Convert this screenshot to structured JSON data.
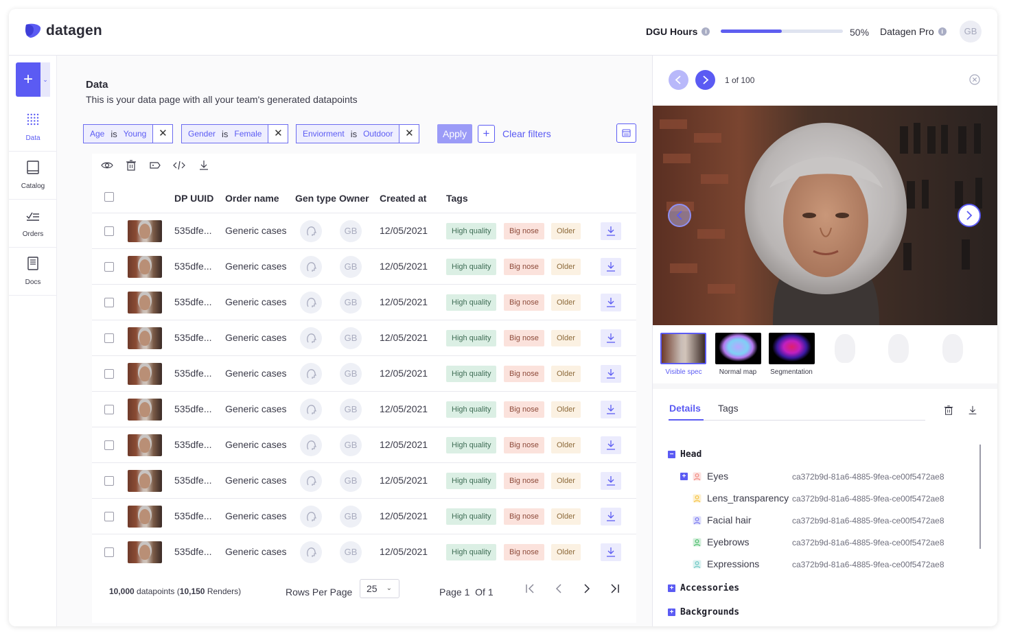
{
  "app": {
    "logo_text": "datagen",
    "brand_color": "#5b5bf3"
  },
  "header": {
    "dgu_label": "DGU Hours",
    "dgu_progress": 0.5,
    "dgu_percent": "50%",
    "plan_label": "Datagen Pro",
    "avatar": "GB"
  },
  "sidebar": {
    "items": [
      {
        "label": "Data",
        "icon": "grid-icon",
        "active": true
      },
      {
        "label": "Catalog",
        "icon": "book-icon",
        "active": false
      },
      {
        "label": "Orders",
        "icon": "checklist-icon",
        "active": false
      },
      {
        "label": "Docs",
        "icon": "document-icon",
        "active": false
      }
    ]
  },
  "page": {
    "title": "Data",
    "subtitle": "This is your data page with all your team's generated datapoints"
  },
  "filters": {
    "chips": [
      {
        "field": "Age",
        "op": "is",
        "value": "Young"
      },
      {
        "field": "Gender",
        "op": "is",
        "value": "Female"
      },
      {
        "field": "Enviorment",
        "op": "is",
        "value": "Outdoor"
      }
    ],
    "apply": "Apply",
    "clear": "Clear filters"
  },
  "table": {
    "columns": [
      "DP UUID",
      "Order name",
      "Gen type",
      "Owner",
      "Created at",
      "Tags"
    ],
    "rows": [
      {
        "uuid": "535dfe...",
        "order": "Generic cases",
        "owner": "GB",
        "created": "12/05/2021",
        "tags": [
          "High quality",
          "Big nose",
          "Older"
        ]
      },
      {
        "uuid": "535dfe...",
        "order": "Generic cases",
        "owner": "GB",
        "created": "12/05/2021",
        "tags": [
          "High quality",
          "Big nose",
          "Older"
        ]
      },
      {
        "uuid": "535dfe...",
        "order": "Generic cases",
        "owner": "GB",
        "created": "12/05/2021",
        "tags": [
          "High quality",
          "Big nose",
          "Older"
        ]
      },
      {
        "uuid": "535dfe...",
        "order": "Generic cases",
        "owner": "GB",
        "created": "12/05/2021",
        "tags": [
          "High quality",
          "Big nose",
          "Older"
        ]
      },
      {
        "uuid": "535dfe...",
        "order": "Generic cases",
        "owner": "GB",
        "created": "12/05/2021",
        "tags": [
          "High quality",
          "Big nose",
          "Older"
        ]
      },
      {
        "uuid": "535dfe...",
        "order": "Generic cases",
        "owner": "GB",
        "created": "12/05/2021",
        "tags": [
          "High quality",
          "Big nose",
          "Older"
        ]
      },
      {
        "uuid": "535dfe...",
        "order": "Generic cases",
        "owner": "GB",
        "created": "12/05/2021",
        "tags": [
          "High quality",
          "Big nose",
          "Older"
        ]
      },
      {
        "uuid": "535dfe...",
        "order": "Generic cases",
        "owner": "GB",
        "created": "12/05/2021",
        "tags": [
          "High quality",
          "Big nose",
          "Older"
        ]
      },
      {
        "uuid": "535dfe...",
        "order": "Generic cases",
        "owner": "GB",
        "created": "12/05/2021",
        "tags": [
          "High quality",
          "Big nose",
          "Older"
        ]
      },
      {
        "uuid": "535dfe...",
        "order": "Generic cases",
        "owner": "GB",
        "created": "12/05/2021",
        "tags": [
          "High quality",
          "Big nose",
          "Older"
        ]
      }
    ]
  },
  "footer": {
    "count": "10,000",
    "count_suffix": "datapoints (",
    "renders": "10,150",
    "renders_suffix": "Renders)",
    "rows_per_page_label": "Rows Per Page",
    "rows_per_page": "25",
    "page_label": "Page",
    "page": "1",
    "of_label": "Of",
    "total_pages": "1"
  },
  "panel": {
    "counter": "1 of 100",
    "thumbnails": [
      {
        "label": "Visible spec",
        "active": true
      },
      {
        "label": "Normal map",
        "active": false
      },
      {
        "label": "Segmentation",
        "active": false
      }
    ],
    "tabs": [
      {
        "label": "Details",
        "active": true
      },
      {
        "label": "Tags",
        "active": false
      }
    ],
    "tree": {
      "head": "Head",
      "children": [
        {
          "label": "Eyes",
          "id": "ca372b9d-81a6-4885-9fea-ce00f5472ae8",
          "color": "#f28b82",
          "expandable": true
        },
        {
          "label": "Lens_transparency",
          "id": "ca372b9d-81a6-4885-9fea-ce00f5472ae8",
          "color": "#f6c445",
          "expandable": false
        },
        {
          "label": "Facial hair",
          "id": "ca372b9d-81a6-4885-9fea-ce00f5472ae8",
          "color": "#7a7aef",
          "expandable": false
        },
        {
          "label": "Eyebrows",
          "id": "ca372b9d-81a6-4885-9fea-ce00f5472ae8",
          "color": "#4fbf6f",
          "expandable": false
        },
        {
          "label": "Expressions",
          "id": "ca372b9d-81a6-4885-9fea-ce00f5472ae8",
          "color": "#6fc9c4",
          "expandable": false
        }
      ],
      "accessories": "Accessories",
      "backgrounds": "Backgrounds"
    }
  }
}
